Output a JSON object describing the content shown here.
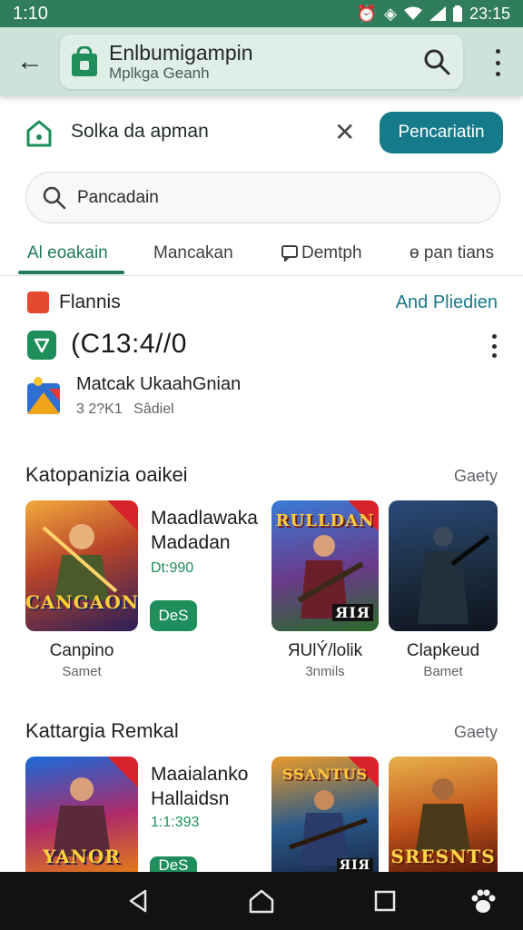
{
  "status_bar": {
    "time": "1:10",
    "clock_right": "23:15"
  },
  "app_bar": {
    "title": "Enlbumigampin",
    "subtitle": "Mplkga Geanh"
  },
  "prompt": {
    "text": "Solka da apman",
    "primary_button": "Pencariatin"
  },
  "search": {
    "placeholder": "Pancadain"
  },
  "tabs": [
    {
      "label": "Al eoakain"
    },
    {
      "label": "Mancakan"
    },
    {
      "label": "Demtph"
    },
    {
      "label": "ɵ pan tians"
    }
  ],
  "info": {
    "row1_label": "Flannis",
    "row1_link": "And Pliedien",
    "code": "(C13:4//0",
    "item_name": "Matcak UkaahGnian",
    "item_meta_size": "3 2?K1",
    "item_meta_label": "Sâdiel"
  },
  "sections": [
    {
      "title": "Katopanizia oaikei",
      "more": "Gaety",
      "featured": {
        "art_text": "CANGAON",
        "title_line1": "Maadlawaka",
        "title_line2": "Madadan",
        "price": "Dt:990",
        "button": "DeS",
        "caption": "Canpino",
        "caption_sub": "Samet"
      },
      "tiles": [
        {
          "art_text": "RULLDAN",
          "corner_text": "ЯIЯ",
          "title": "ЯUlÝ/lolik",
          "sub": "3nmils"
        },
        {
          "art_text": "",
          "corner_text": "",
          "title": "Clapkeud",
          "sub": "Bamet"
        }
      ]
    },
    {
      "title": "Kattargia Remkal",
      "more": "Gaety",
      "featured": {
        "art_text": "YANOR",
        "title_line1": "Maaialanko",
        "title_line2": "Hallaidsn",
        "price": "1:1:393",
        "button": "DeS",
        "caption": "",
        "caption_sub": ""
      },
      "tiles": [
        {
          "art_text": "SSANTUS",
          "corner_text": "ЯIЯ",
          "title": "",
          "sub": ""
        },
        {
          "art_text": "SRESNTS",
          "corner_text": "",
          "title": "",
          "sub": ""
        }
      ]
    }
  ],
  "colors": {
    "primary": "#1f7a5a",
    "accent_button": "#157a8a",
    "status_bar": "#2f7d5b",
    "app_bar": "#cde3d9"
  }
}
